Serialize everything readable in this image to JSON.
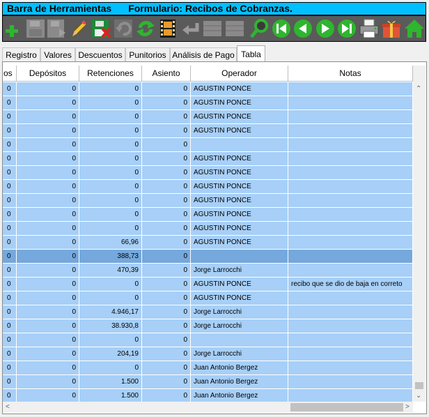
{
  "title": {
    "toolbar_title": "Barra de Herramientas",
    "form_title": "Formulario: Recibos de Cobranzas."
  },
  "toolbar": {
    "buttons": [
      "add",
      "save",
      "save-disabled",
      "edit",
      "save-delete",
      "undo",
      "refresh",
      "film",
      "back",
      "grid1",
      "grid2",
      "search",
      "first",
      "prev",
      "next",
      "last",
      "print",
      "gift",
      "home"
    ]
  },
  "tabs": [
    "Registro",
    "Valores",
    "Descuentos",
    "Punitorios",
    "Análisis de Pago",
    "Tabla"
  ],
  "active_tab": "Tabla",
  "grid": {
    "columns": [
      "os",
      "Depósitos",
      "Retenciones",
      "Asiento",
      "Operador",
      "Notas"
    ],
    "rows": [
      [
        "0",
        "0",
        "0",
        "0",
        "AGUSTIN PONCE",
        ""
      ],
      [
        "0",
        "0",
        "0",
        "0",
        "AGUSTIN PONCE",
        ""
      ],
      [
        "0",
        "0",
        "0",
        "0",
        "AGUSTIN PONCE",
        ""
      ],
      [
        "0",
        "0",
        "0",
        "0",
        "AGUSTIN PONCE",
        ""
      ],
      [
        "0",
        "0",
        "0",
        "0",
        "",
        ""
      ],
      [
        "0",
        "0",
        "0",
        "0",
        "AGUSTIN PONCE",
        ""
      ],
      [
        "0",
        "0",
        "0",
        "0",
        "AGUSTIN PONCE",
        ""
      ],
      [
        "0",
        "0",
        "0",
        "0",
        "AGUSTIN PONCE",
        ""
      ],
      [
        "0",
        "0",
        "0",
        "0",
        "AGUSTIN PONCE",
        ""
      ],
      [
        "0",
        "0",
        "0",
        "0",
        "AGUSTIN PONCE",
        ""
      ],
      [
        "0",
        "0",
        "0",
        "0",
        "AGUSTIN PONCE",
        ""
      ],
      [
        "0",
        "0",
        "66,96",
        "0",
        "AGUSTIN PONCE",
        ""
      ],
      [
        "0",
        "0",
        "388,73",
        "0",
        "",
        ""
      ],
      [
        "0",
        "0",
        "470,39",
        "0",
        "Jorge Larrocchi",
        ""
      ],
      [
        "0",
        "0",
        "0",
        "0",
        "AGUSTIN PONCE",
        "recibo que se dio de baja en correto"
      ],
      [
        "0",
        "0",
        "0",
        "0",
        "AGUSTIN PONCE",
        ""
      ],
      [
        "0",
        "0",
        "4.946,17",
        "0",
        "Jorge Larrocchi",
        ""
      ],
      [
        "0",
        "0",
        "38.930,8",
        "0",
        "Jorge Larrocchi",
        ""
      ],
      [
        "0",
        "0",
        "0",
        "0",
        "",
        ""
      ],
      [
        "0",
        "0",
        "204,19",
        "0",
        "Jorge Larrocchi",
        ""
      ],
      [
        "0",
        "0",
        "0",
        "0",
        "Juan Antonio Bergez",
        ""
      ],
      [
        "0",
        "0",
        "1.500",
        "0",
        "Juan Antonio Bergez",
        ""
      ],
      [
        "0",
        "0",
        "1.500",
        "0",
        "Juan Antonio Bergez",
        ""
      ]
    ],
    "selected_row": 12
  },
  "colors": {
    "title_bg": "#00c0ff",
    "toolbar_bg": "#5a5a5a",
    "row_bg": "#a7cff7",
    "selected_row_bg": "#75a8dc",
    "nav_green": "#2fb52f"
  }
}
